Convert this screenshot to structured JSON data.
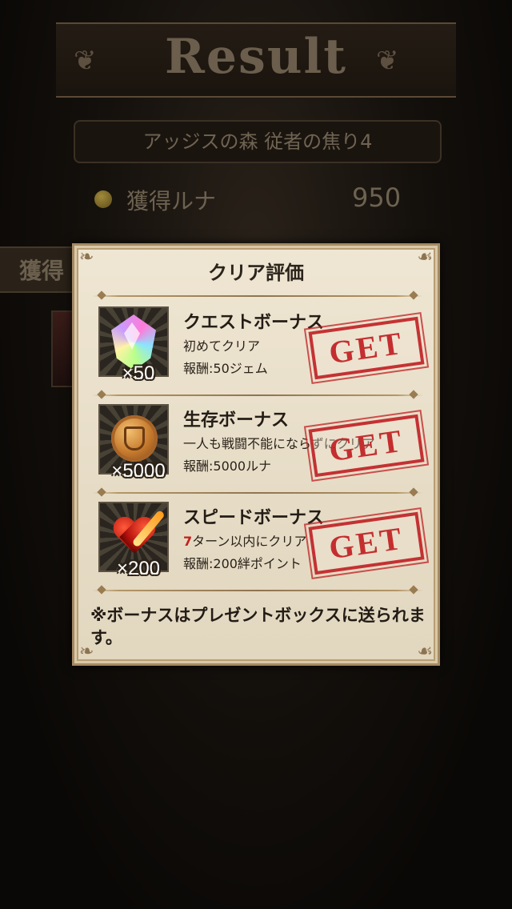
{
  "background": {
    "title": "Result",
    "stage_name": "アッジスの森 従者の焦り4",
    "luna_label": "獲得ルナ",
    "luna_value": "950",
    "obtained_tab": "獲得"
  },
  "dialog": {
    "title": "クリア評価",
    "bonuses": [
      {
        "name": "クエストボーナス",
        "condition": "初めてクリア",
        "reward": "報酬:50ジェム",
        "quantity": "×50",
        "icon": "rainbow-gem-icon",
        "stamp": "GET"
      },
      {
        "name": "生存ボーナス",
        "condition": "一人も戦闘不能にならずにクリア",
        "reward": "報酬:5000ルナ",
        "quantity": "×5000",
        "icon": "luna-coin-icon",
        "stamp": "GET"
      },
      {
        "name": "スピードボーナス",
        "condition_highlight": "7",
        "condition": "ターン以内にクリア",
        "reward": "報酬:200絆ポイント",
        "quantity": "×200",
        "icon": "bond-heart-icon",
        "stamp": "GET"
      }
    ],
    "footer_note": "※ボーナスはプレゼントボックスに送られます。"
  },
  "colors": {
    "stamp_red": "#c01e22",
    "highlight_red": "#c41f1b",
    "parchment": "#e8dfca"
  }
}
